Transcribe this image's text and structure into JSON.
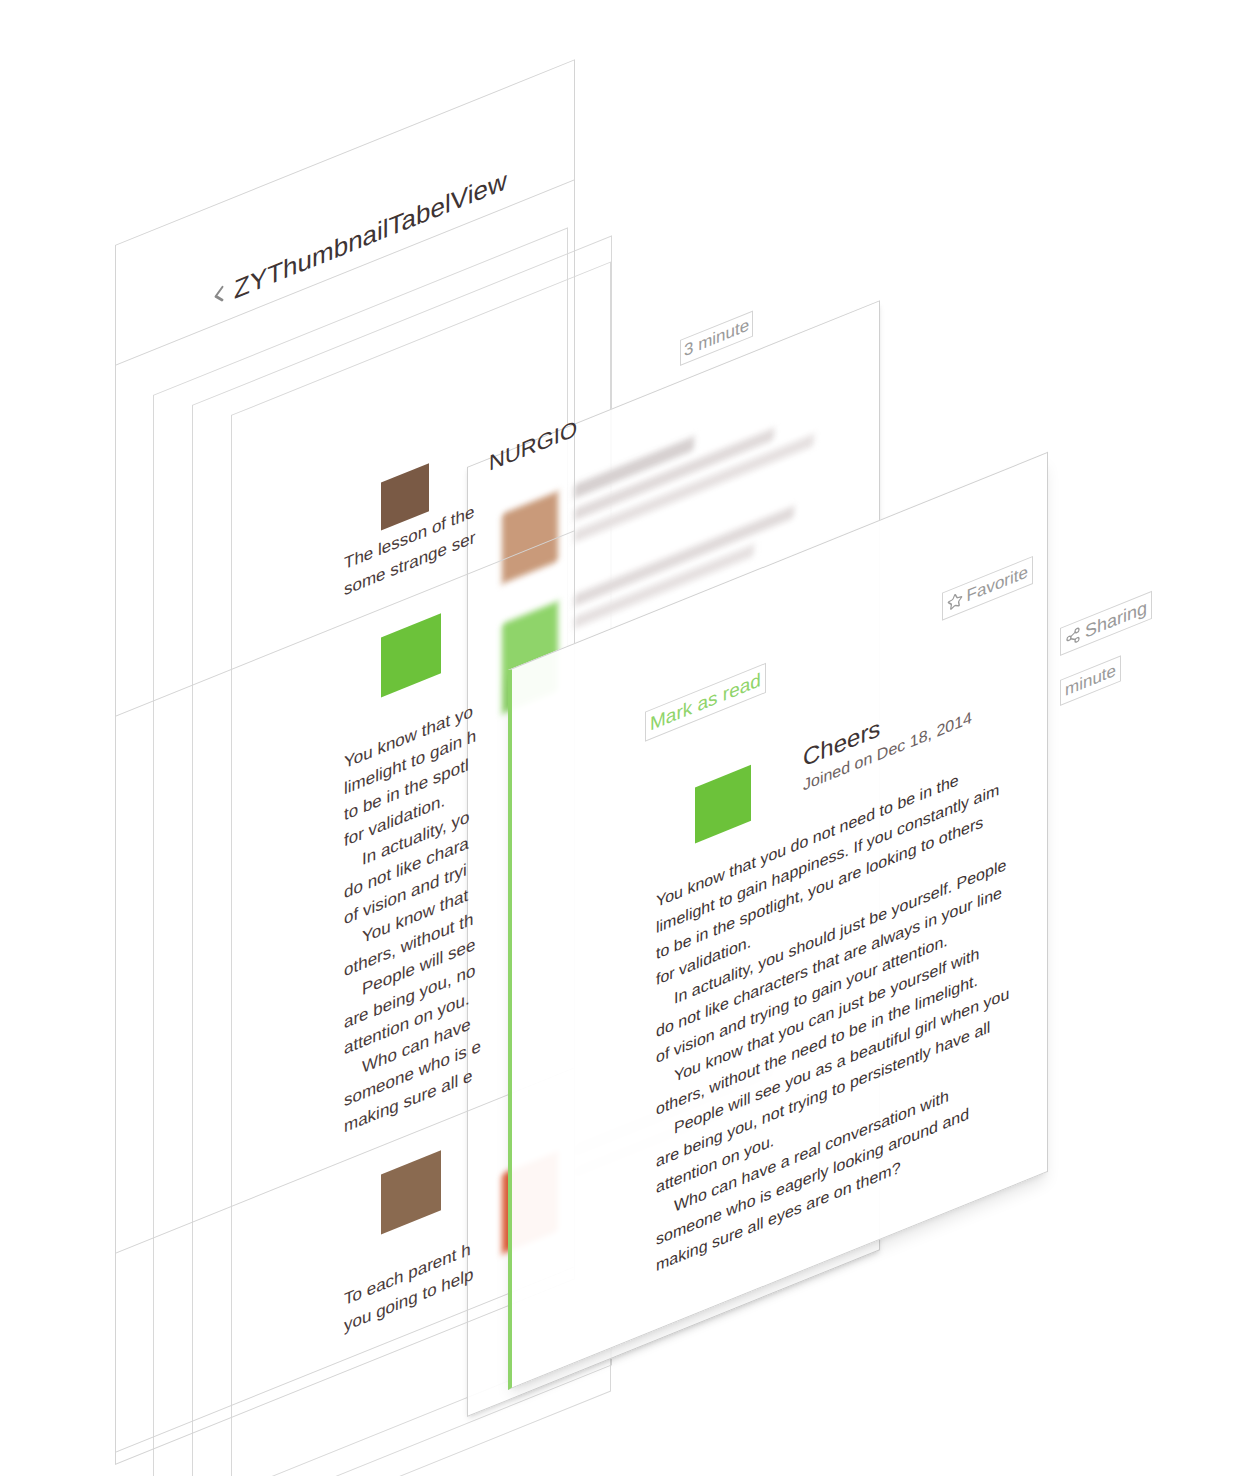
{
  "window": {
    "title": "ZYThumbnailTabelView"
  },
  "floating_labels": [
    {
      "text": "3 minute"
    }
  ],
  "back_cells": [
    {
      "name": "NURGIO",
      "color": "#7a5a45",
      "paragraphs": [
        [
          "The lesson of the",
          "some strange ser"
        ]
      ]
    },
    {
      "name": "",
      "color": "#6cc23a",
      "paragraphs": [
        [
          "You know that yo",
          "limelight to gain h",
          "to be in the spotl",
          "for validation."
        ],
        [
          "In actuality, yo",
          "do not like chara",
          "of vision and tryi"
        ],
        [
          "You know that",
          "others, without th"
        ],
        [
          "People will see",
          "are being you, no",
          "attention on you."
        ],
        [
          "Who can have",
          "someone who is e",
          "making sure all e"
        ]
      ]
    },
    {
      "name": "",
      "color": "#8a6a50",
      "paragraphs": [
        [
          "To each parent h",
          "you going to help"
        ]
      ]
    }
  ],
  "expanded_cell": {
    "mark_read": "Mark as read",
    "favorite": "Favorite",
    "time": "minute",
    "sharing": "Sharing",
    "name": "Cheers",
    "joined": "Joined on Dec 18, 2014",
    "color": "#6cc23a",
    "paragraphs": [
      [
        "You know that you do not need to be in the",
        "limelight to gain happiness. If you constantly aim",
        "to be in the spotlight, you are looking to others",
        "for validation."
      ],
      [
        "In actuality, you should just be yourself. People",
        "do not like characters that are always in your line",
        "of vision and trying to gain your attention."
      ],
      [
        "You know that you can just be yourself with",
        "others, without the need to be in the limelight."
      ],
      [
        "People will see you as a beautiful girl when you",
        "are being you, not trying to persistently have all",
        "attention on you."
      ],
      [
        "Who can have a real conversation with",
        "someone who is eagerly looking around and",
        "making sure all eyes are on them?"
      ]
    ]
  }
}
